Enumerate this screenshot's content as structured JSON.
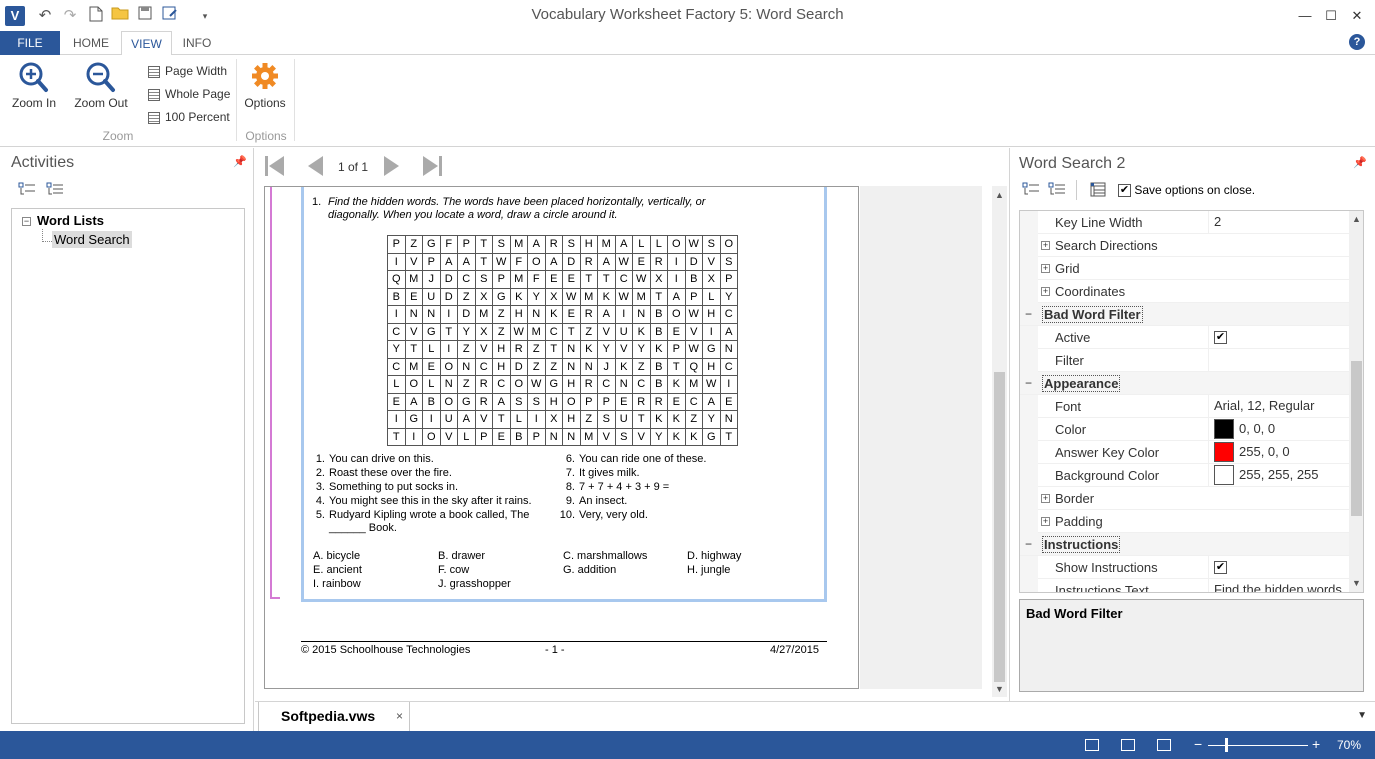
{
  "window": {
    "title": "Vocabulary Worksheet Factory 5: Word Search",
    "logo": "V",
    "qat_icons": [
      "undo-icon",
      "redo-icon",
      "new-document-icon",
      "open-folder-icon",
      "save-icon",
      "save-as-icon",
      "customize-dropdown-icon"
    ],
    "controls": {
      "minimize": "—",
      "maximize": "☐",
      "close": "✕"
    },
    "help": "?"
  },
  "ribbon": {
    "tabs": [
      {
        "label": "FILE"
      },
      {
        "label": "HOME"
      },
      {
        "label": "VIEW"
      },
      {
        "label": "INFO"
      }
    ],
    "active_tab": "VIEW",
    "zoom_in": "Zoom In",
    "zoom_out": "Zoom Out",
    "page_width": "Page Width",
    "whole_page": "Whole Page",
    "hundred_percent": "100 Percent",
    "options": "Options",
    "group_zoom": "Zoom",
    "group_options": "Options"
  },
  "activities": {
    "title": "Activities",
    "root": "Word Lists",
    "child": "Word Search",
    "expander": "−"
  },
  "navigation": {
    "page_indicator": "1 of 1"
  },
  "worksheet": {
    "instruction_number": "1.",
    "instruction": "Find the hidden words. The words have been placed horizontally, vertically, or diagonally. When you locate a word, draw a circle around it.",
    "grid": [
      "PZGFPTSMARSHMALLOWSO",
      "IVPAATWFOADRAWERIDVS",
      "QMJDCSPMFEETTCWXIBXP",
      "BEUDZXGKYXWMKWMTAPLY",
      "INNIDMZHNKERAINBOWHC",
      "CVGTYXZWMCTZVUKBEVIA",
      "YTLIZVHRZTNKYVYKPWGN",
      "CMEONCHDZZNNJKZBTQHC",
      "LOLNZRCOWGHRCNCBKMWI",
      "EABOGRASSHOPPERRECAE",
      "IGIUAVTLIXHZSUTKKZYN",
      "TIOVLPEBPNNMVSVYKKGT"
    ],
    "clues_left": [
      {
        "n": "1.",
        "t": "You can drive on this."
      },
      {
        "n": "2.",
        "t": "Roast these over the fire."
      },
      {
        "n": "3.",
        "t": "Something to put socks in."
      },
      {
        "n": "4.",
        "t": "You might see this in the sky after it rains."
      },
      {
        "n": "5.",
        "t": "Rudyard Kipling wrote a book called, The ______ Book."
      }
    ],
    "clues_right": [
      {
        "n": "6.",
        "t": "You can ride one of these."
      },
      {
        "n": "7.",
        "t": "It gives milk."
      },
      {
        "n": "8.",
        "t": "7 + 7 + 4 + 3 + 9 ="
      },
      {
        "n": "9.",
        "t": "An insect."
      },
      {
        "n": "10.",
        "t": "Very, very old."
      }
    ],
    "answers": [
      [
        "A.  bicycle",
        "B.  drawer",
        "C.  marshmallows",
        "D.  highway"
      ],
      [
        "E.  ancient",
        "F.  cow",
        "G.  addition",
        "H.  jungle"
      ],
      [
        "I.  rainbow",
        "J.  grasshopper",
        "",
        ""
      ]
    ],
    "footer_left": "© 2015 Schoolhouse Technologies",
    "footer_center": "- 1 -",
    "footer_right": "4/27/2015"
  },
  "document_tab": {
    "label": "Softpedia.vws",
    "close": "×",
    "dropdown": "▼"
  },
  "properties": {
    "title": "Word Search 2",
    "save_on_close": "Save options on close.",
    "save_checked": "✔",
    "rows": [
      {
        "type": "prop",
        "name": "Key Line Width",
        "value": "2"
      },
      {
        "type": "group",
        "name": "Search Directions",
        "expander": "+"
      },
      {
        "type": "group",
        "name": "Grid",
        "expander": "+"
      },
      {
        "type": "group",
        "name": "Coordinates",
        "expander": "+"
      },
      {
        "type": "cat",
        "name": "Bad Word Filter",
        "expander": "−"
      },
      {
        "type": "check",
        "name": "Active",
        "value": "✔"
      },
      {
        "type": "prop",
        "name": "Filter",
        "value": ""
      },
      {
        "type": "cat",
        "name": "Appearance",
        "expander": "−"
      },
      {
        "type": "prop",
        "name": "Font",
        "value": "Arial, 12, Regular"
      },
      {
        "type": "color",
        "name": "Color",
        "value": "0, 0, 0",
        "swatch": "#000000"
      },
      {
        "type": "color",
        "name": "Answer Key Color",
        "value": "255, 0, 0",
        "swatch": "#ff0000"
      },
      {
        "type": "color",
        "name": "Background Color",
        "value": "255, 255, 255",
        "swatch": "#ffffff"
      },
      {
        "type": "group",
        "name": "Border",
        "expander": "+"
      },
      {
        "type": "group",
        "name": "Padding",
        "expander": "+"
      },
      {
        "type": "cat",
        "name": "Instructions",
        "expander": "−"
      },
      {
        "type": "check",
        "name": "Show Instructions",
        "value": "✔"
      },
      {
        "type": "prop",
        "name": "Instructions Text",
        "value": "Find the hidden words."
      }
    ],
    "description_title": "Bad Word Filter"
  },
  "statusbar": {
    "zoom_minus": "−",
    "zoom_plus": "+",
    "zoom_level": "70%"
  },
  "colors": {
    "accent": "#2b579a",
    "highlight_pink": "#d47ad4",
    "border_blue": "#a8c8ee"
  }
}
